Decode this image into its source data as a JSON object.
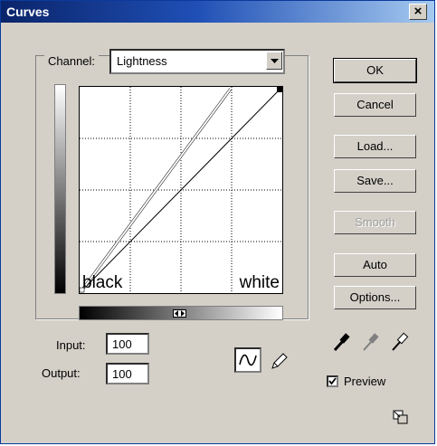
{
  "window": {
    "title": "Curves",
    "close_glyph": "×"
  },
  "channel": {
    "label": "Channel:",
    "value": "Lightness"
  },
  "curve": {
    "left_label": "black",
    "right_label": "white"
  },
  "fields": {
    "input_label": "Input:",
    "input_value": "100",
    "output_label": "Output:",
    "output_value": "100"
  },
  "buttons": {
    "ok": "OK",
    "cancel": "Cancel",
    "load": "Load...",
    "save": "Save...",
    "smooth": "Smooth",
    "auto": "Auto",
    "options": "Options..."
  },
  "preview": {
    "label": "Preview",
    "checked": true
  },
  "icons": [
    "chevron-down-icon",
    "curve-tool-icon",
    "pencil-icon",
    "black-eyedropper-icon",
    "gray-eyedropper-icon",
    "white-eyedropper-icon",
    "resize-icon"
  ]
}
